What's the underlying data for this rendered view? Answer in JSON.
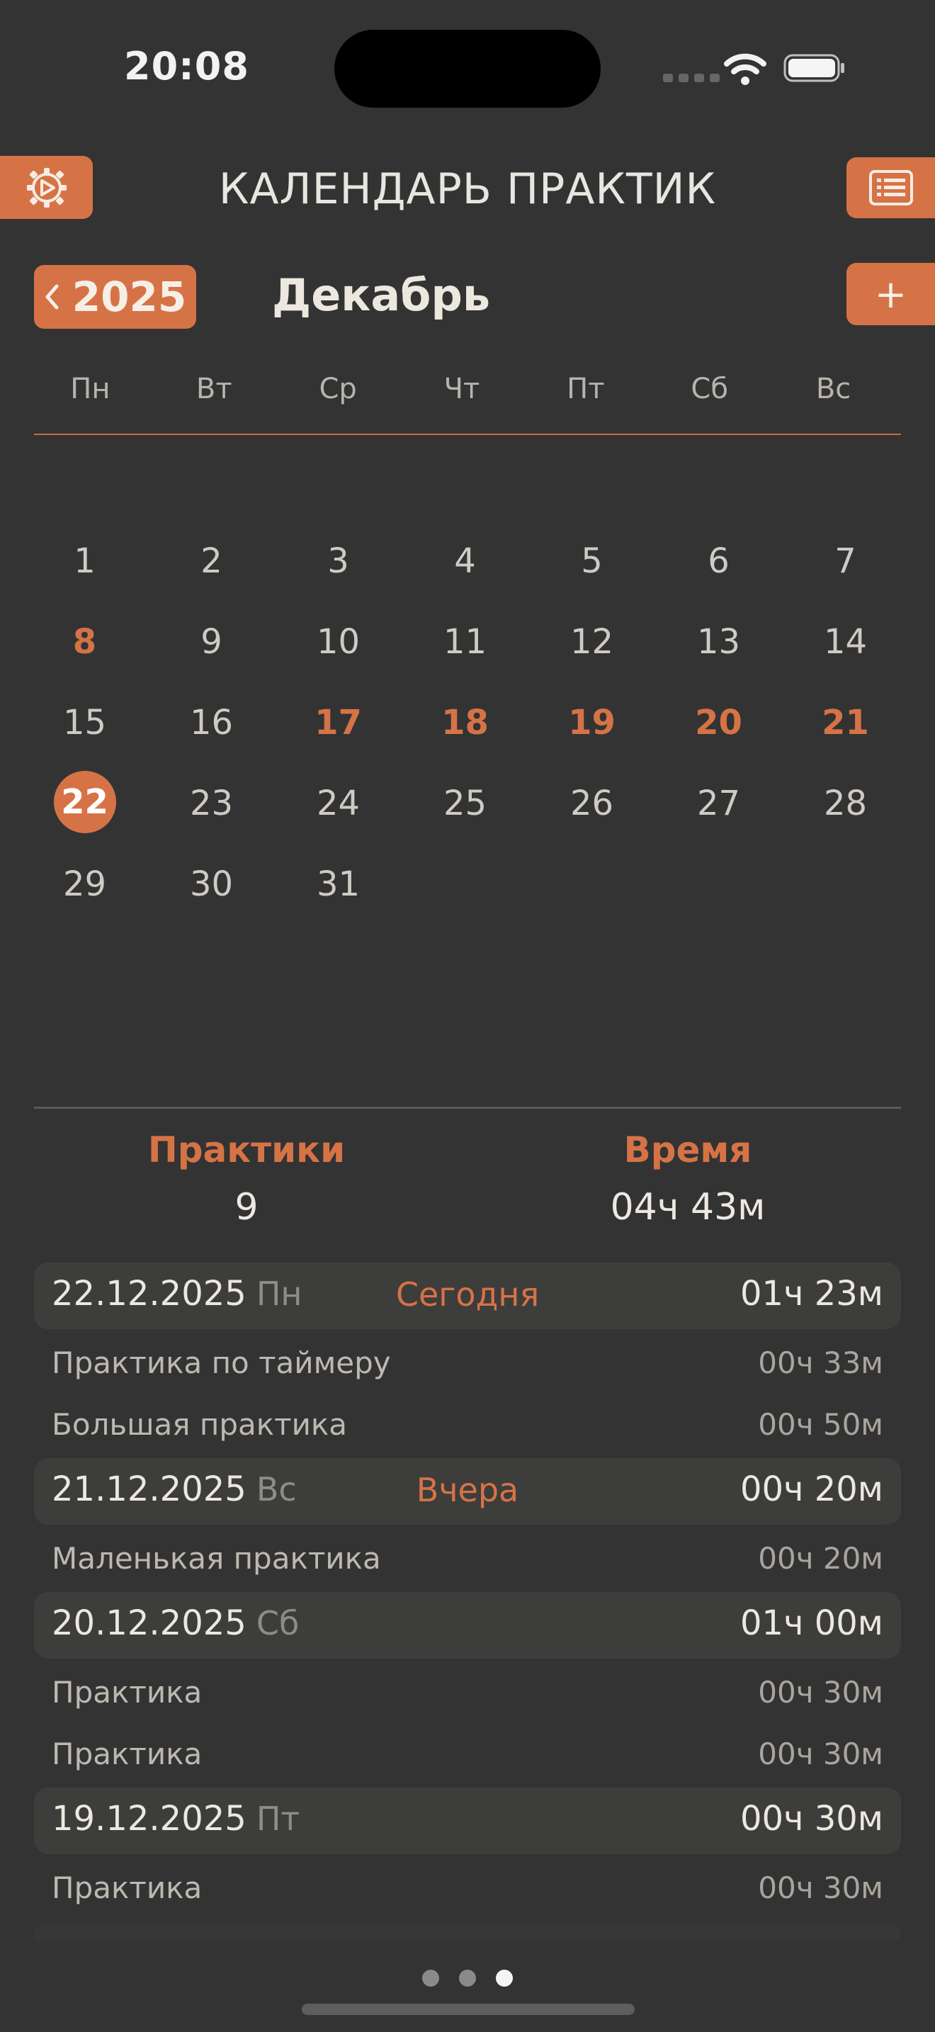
{
  "status": {
    "time": "20:08"
  },
  "header": {
    "title": "КАЛЕНДАРЬ ПРАКТИК"
  },
  "nav": {
    "year": "2025",
    "month": "Декабрь",
    "add_label": "+"
  },
  "weekdays": [
    "Пн",
    "Вт",
    "Ср",
    "Чт",
    "Пт",
    "Сб",
    "Вс"
  ],
  "calendar": {
    "days": [
      {
        "n": "1"
      },
      {
        "n": "2"
      },
      {
        "n": "3"
      },
      {
        "n": "4"
      },
      {
        "n": "5"
      },
      {
        "n": "6"
      },
      {
        "n": "7"
      },
      {
        "n": "8",
        "hl": true
      },
      {
        "n": "9"
      },
      {
        "n": "10"
      },
      {
        "n": "11"
      },
      {
        "n": "12"
      },
      {
        "n": "13"
      },
      {
        "n": "14"
      },
      {
        "n": "15"
      },
      {
        "n": "16"
      },
      {
        "n": "17",
        "hl": true
      },
      {
        "n": "18",
        "hl": true
      },
      {
        "n": "19",
        "hl": true
      },
      {
        "n": "20",
        "hl": true
      },
      {
        "n": "21",
        "hl": true
      },
      {
        "n": "22",
        "today": true
      },
      {
        "n": "23"
      },
      {
        "n": "24"
      },
      {
        "n": "25"
      },
      {
        "n": "26"
      },
      {
        "n": "27"
      },
      {
        "n": "28"
      },
      {
        "n": "29"
      },
      {
        "n": "30"
      },
      {
        "n": "31"
      }
    ]
  },
  "stats": {
    "practices_label": "Практики",
    "practices_value": "9",
    "time_label": "Время",
    "time_value": "04ч 43м"
  },
  "log": [
    {
      "date": "22.12.2025",
      "dow": "Пн",
      "rel": "Сегодня",
      "total": "01ч 23м",
      "items": [
        {
          "name": "Практика по таймеру",
          "dur": "00ч 33м"
        },
        {
          "name": "Большая практика",
          "dur": "00ч 50м"
        }
      ]
    },
    {
      "date": "21.12.2025",
      "dow": "Вс",
      "rel": "Вчера",
      "total": "00ч 20м",
      "items": [
        {
          "name": "Маленькая практика",
          "dur": "00ч 20м"
        }
      ]
    },
    {
      "date": "20.12.2025",
      "dow": "Сб",
      "rel": "",
      "total": "01ч 00м",
      "items": [
        {
          "name": "Практика",
          "dur": "00ч 30м"
        },
        {
          "name": "Практика",
          "dur": "00ч 30м"
        }
      ]
    },
    {
      "date": "19.12.2025",
      "dow": "Пт",
      "rel": "",
      "total": "00ч 30м",
      "items": [
        {
          "name": "Практика",
          "dur": "00ч 30м"
        }
      ]
    }
  ],
  "pager": {
    "pages": 3,
    "current": 3
  },
  "colors": {
    "accent": "#d67346",
    "background": "#333333"
  }
}
